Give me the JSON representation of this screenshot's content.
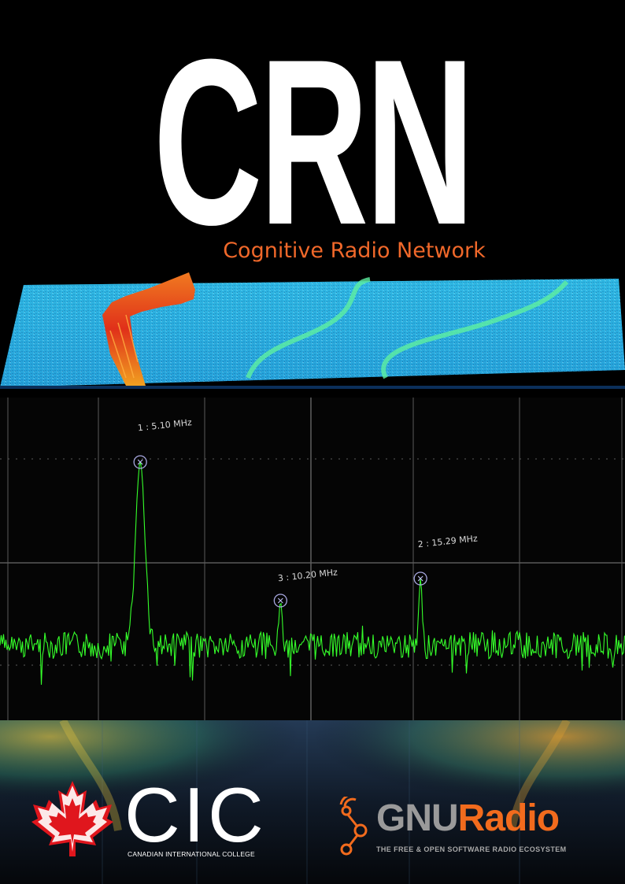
{
  "poster": {
    "title": "CRN",
    "subtitle": "Cognitive Radio Network"
  },
  "spectrum": {
    "markers": [
      {
        "label": "1 : 5.10 MHz",
        "freq_mhz": 5.1
      },
      {
        "label": "3 : 10.20 MHz",
        "freq_mhz": 10.2
      },
      {
        "label": "2 : 15.29 MHz",
        "freq_mhz": 15.29
      }
    ],
    "trace_color": "#35ff2a",
    "grid_color": "#5a5a5a"
  },
  "logos": {
    "cic": {
      "letters": "CIC",
      "full_name": "CANADIAN INTERNATIONAL COLLEGE",
      "icon": "maple-leaf-icon",
      "color": "#e0161d"
    },
    "gnuradio": {
      "word_gnu": "GNU",
      "word_radio": "Radio",
      "tagline": "THE FREE & OPEN SOFTWARE RADIO ECOSYSTEM",
      "icon": "signal-nodes-icon",
      "accent": "#f26b1d"
    }
  }
}
